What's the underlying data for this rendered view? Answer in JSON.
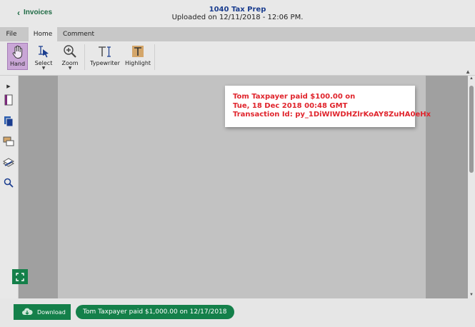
{
  "header": {
    "back_label": "Invoices",
    "title": "1040 Tax Prep",
    "subtitle": "Uploaded on 12/11/2018 - 12:06 PM."
  },
  "menu_tabs": [
    {
      "label": "File",
      "active": false
    },
    {
      "label": "Home",
      "active": true
    },
    {
      "label": "Comment",
      "active": false
    }
  ],
  "toolbar": {
    "hand": "Hand",
    "select": "Select",
    "zoom": "Zoom",
    "typewriter": "Typewriter",
    "highlight": "Highlight"
  },
  "receipt": {
    "line1": "Tom Taxpayer paid $100.00 on",
    "line2": "Tue, 18 Dec 2018 00:48 GMT",
    "line3": "Transaction Id: py_1DiWIWDHZlrKoAY8ZuHA0eHx"
  },
  "footer": {
    "download_label": "Download",
    "paid_status": "Tom Taxpayer paid $1,000.00 on 12/17/2018"
  },
  "colors": {
    "accent_green": "#14804a",
    "hand_active": "#c9a6d6",
    "receipt_text": "#e0242c",
    "title_blue": "#1a3d8f"
  },
  "icons": [
    "chevron-left-icon",
    "hand-icon",
    "select-cursor-icon",
    "zoom-icon",
    "typewriter-icon",
    "highlight-icon",
    "expand-arrow-icon",
    "pages-icon",
    "copy-pages-icon",
    "comments-icon",
    "layers-icon",
    "search-icon",
    "fullscreen-icon",
    "cloud-download-icon"
  ]
}
